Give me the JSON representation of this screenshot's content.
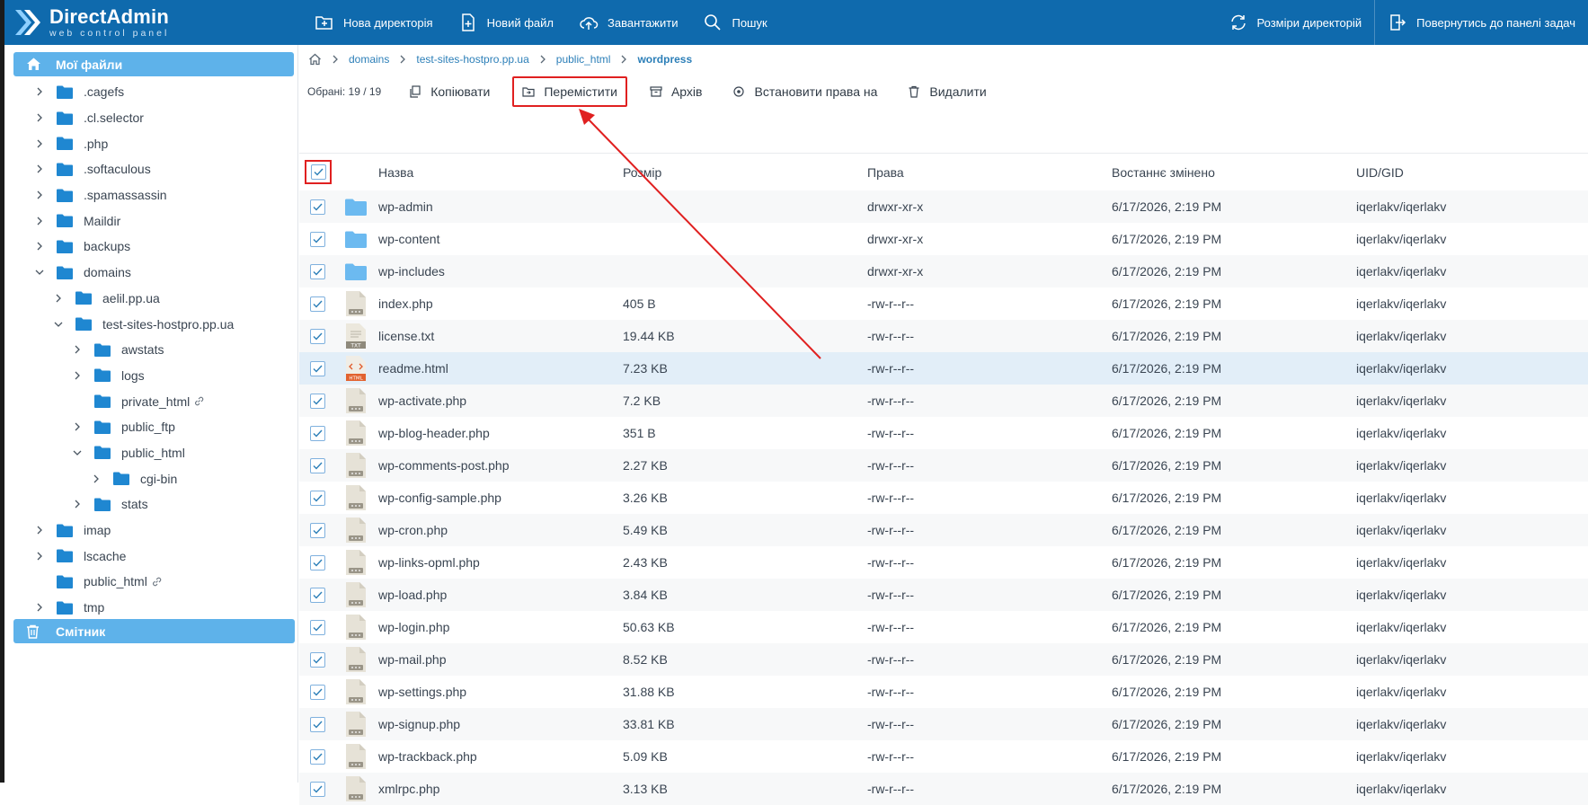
{
  "brand": {
    "title": "DirectAdmin",
    "subtitle": "web control panel"
  },
  "topbar": {
    "new_dir": "Нова директорія",
    "new_file": "Новий файл",
    "upload": "Завантажити",
    "search": "Пошук",
    "dir_sizes": "Розміри директорій",
    "back": "Повернутись до панелі задач"
  },
  "sidebar": {
    "root": "Мої файли",
    "trash": "Смітник",
    "tree": [
      {
        "label": ".cagefs",
        "depth": 0,
        "chev": "right"
      },
      {
        "label": ".cl.selector",
        "depth": 0,
        "chev": "right"
      },
      {
        "label": ".php",
        "depth": 0,
        "chev": "right"
      },
      {
        "label": ".softaculous",
        "depth": 0,
        "chev": "right"
      },
      {
        "label": ".spamassassin",
        "depth": 0,
        "chev": "right"
      },
      {
        "label": "Maildir",
        "depth": 0,
        "chev": "right"
      },
      {
        "label": "backups",
        "depth": 0,
        "chev": "right"
      },
      {
        "label": "domains",
        "depth": 0,
        "chev": "down"
      },
      {
        "label": "aelil.pp.ua",
        "depth": 1,
        "chev": "right"
      },
      {
        "label": "test-sites-hostpro.pp.ua",
        "depth": 1,
        "chev": "down"
      },
      {
        "label": "awstats",
        "depth": 2,
        "chev": "right"
      },
      {
        "label": "logs",
        "depth": 2,
        "chev": "right"
      },
      {
        "label": "private_html",
        "depth": 2,
        "chev": "none",
        "link": true
      },
      {
        "label": "public_ftp",
        "depth": 2,
        "chev": "right"
      },
      {
        "label": "public_html",
        "depth": 2,
        "chev": "down"
      },
      {
        "label": "cgi-bin",
        "depth": 3,
        "chev": "right"
      },
      {
        "label": "stats",
        "depth": 2,
        "chev": "right"
      },
      {
        "label": "imap",
        "depth": 0,
        "chev": "right"
      },
      {
        "label": "lscache",
        "depth": 0,
        "chev": "right"
      },
      {
        "label": "public_html",
        "depth": 0,
        "chev": "none",
        "link": true
      },
      {
        "label": "tmp",
        "depth": 0,
        "chev": "right"
      }
    ]
  },
  "breadcrumb": [
    "domains",
    "test-sites-hostpro.pp.ua",
    "public_html",
    "wordpress"
  ],
  "actions": {
    "selected": "Обрані: 19 / 19",
    "copy": "Копіювати",
    "move": "Перемістити",
    "archive": "Архів",
    "perms": "Встановити права на",
    "delete": "Видалити"
  },
  "table": {
    "headers": {
      "name": "Назва",
      "size": "Розмір",
      "perms": "Права",
      "modified": "Востаннє змінено",
      "uid": "UID/GID"
    },
    "rows": [
      {
        "name": "wp-admin",
        "size": "",
        "perms": "drwxr-xr-x",
        "modified": "6/17/2026, 2:19 PM",
        "uid": "iqerlakv/iqerlakv",
        "type": "folder"
      },
      {
        "name": "wp-content",
        "size": "",
        "perms": "drwxr-xr-x",
        "modified": "6/17/2026, 2:19 PM",
        "uid": "iqerlakv/iqerlakv",
        "type": "folder"
      },
      {
        "name": "wp-includes",
        "size": "",
        "perms": "drwxr-xr-x",
        "modified": "6/17/2026, 2:19 PM",
        "uid": "iqerlakv/iqerlakv",
        "type": "folder"
      },
      {
        "name": "index.php",
        "size": "405 B",
        "perms": "-rw-r--r--",
        "modified": "6/17/2026, 2:19 PM",
        "uid": "iqerlakv/iqerlakv",
        "type": "file"
      },
      {
        "name": "license.txt",
        "size": "19.44 KB",
        "perms": "-rw-r--r--",
        "modified": "6/17/2026, 2:19 PM",
        "uid": "iqerlakv/iqerlakv",
        "type": "txt",
        "badge": "TXT"
      },
      {
        "name": "readme.html",
        "size": "7.23 KB",
        "perms": "-rw-r--r--",
        "modified": "6/17/2026, 2:19 PM",
        "uid": "iqerlakv/iqerlakv",
        "type": "html",
        "badge": "HTML"
      },
      {
        "name": "wp-activate.php",
        "size": "7.2 KB",
        "perms": "-rw-r--r--",
        "modified": "6/17/2026, 2:19 PM",
        "uid": "iqerlakv/iqerlakv",
        "type": "file"
      },
      {
        "name": "wp-blog-header.php",
        "size": "351 B",
        "perms": "-rw-r--r--",
        "modified": "6/17/2026, 2:19 PM",
        "uid": "iqerlakv/iqerlakv",
        "type": "file"
      },
      {
        "name": "wp-comments-post.php",
        "size": "2.27 KB",
        "perms": "-rw-r--r--",
        "modified": "6/17/2026, 2:19 PM",
        "uid": "iqerlakv/iqerlakv",
        "type": "file"
      },
      {
        "name": "wp-config-sample.php",
        "size": "3.26 KB",
        "perms": "-rw-r--r--",
        "modified": "6/17/2026, 2:19 PM",
        "uid": "iqerlakv/iqerlakv",
        "type": "file"
      },
      {
        "name": "wp-cron.php",
        "size": "5.49 KB",
        "perms": "-rw-r--r--",
        "modified": "6/17/2026, 2:19 PM",
        "uid": "iqerlakv/iqerlakv",
        "type": "file"
      },
      {
        "name": "wp-links-opml.php",
        "size": "2.43 KB",
        "perms": "-rw-r--r--",
        "modified": "6/17/2026, 2:19 PM",
        "uid": "iqerlakv/iqerlakv",
        "type": "file"
      },
      {
        "name": "wp-load.php",
        "size": "3.84 KB",
        "perms": "-rw-r--r--",
        "modified": "6/17/2026, 2:19 PM",
        "uid": "iqerlakv/iqerlakv",
        "type": "file"
      },
      {
        "name": "wp-login.php",
        "size": "50.63 KB",
        "perms": "-rw-r--r--",
        "modified": "6/17/2026, 2:19 PM",
        "uid": "iqerlakv/iqerlakv",
        "type": "file"
      },
      {
        "name": "wp-mail.php",
        "size": "8.52 KB",
        "perms": "-rw-r--r--",
        "modified": "6/17/2026, 2:19 PM",
        "uid": "iqerlakv/iqerlakv",
        "type": "file"
      },
      {
        "name": "wp-settings.php",
        "size": "31.88 KB",
        "perms": "-rw-r--r--",
        "modified": "6/17/2026, 2:19 PM",
        "uid": "iqerlakv/iqerlakv",
        "type": "file"
      },
      {
        "name": "wp-signup.php",
        "size": "33.81 KB",
        "perms": "-rw-r--r--",
        "modified": "6/17/2026, 2:19 PM",
        "uid": "iqerlakv/iqerlakv",
        "type": "file"
      },
      {
        "name": "wp-trackback.php",
        "size": "5.09 KB",
        "perms": "-rw-r--r--",
        "modified": "6/17/2026, 2:19 PM",
        "uid": "iqerlakv/iqerlakv",
        "type": "file"
      },
      {
        "name": "xmlrpc.php",
        "size": "3.13 KB",
        "perms": "-rw-r--r--",
        "modified": "6/17/2026, 2:19 PM",
        "uid": "iqerlakv/iqerlakv",
        "type": "file"
      }
    ]
  },
  "colors": {
    "topbar": "#0f6aad",
    "sidebar_active": "#5eb2ea",
    "link": "#2c7fb8",
    "highlight": "#e02020",
    "folder": "#1f87d1"
  }
}
